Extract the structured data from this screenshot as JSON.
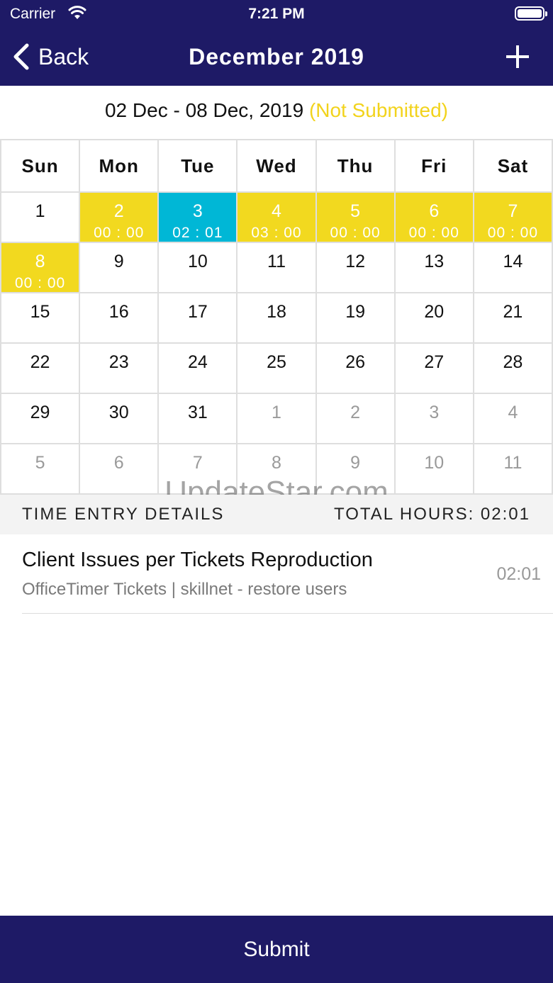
{
  "status_bar": {
    "carrier": "Carrier",
    "time": "7:21 PM",
    "wifi_icon": "wifi-icon",
    "battery_icon": "battery-icon"
  },
  "nav": {
    "back_label": "Back",
    "title": "December 2019",
    "add_icon": "plus-icon"
  },
  "week": {
    "range": "02 Dec - 08 Dec, 2019",
    "status": "(Not Submitted)"
  },
  "colors": {
    "header": "#1e1a66",
    "pending": "#f2d91f",
    "selected": "#00b7d6",
    "status": "#f2d31c"
  },
  "calendar": {
    "weekdays": [
      "Sun",
      "Mon",
      "Tue",
      "Wed",
      "Thu",
      "Fri",
      "Sat"
    ],
    "weeks": [
      [
        {
          "day": "1",
          "hours": "",
          "state": "normal"
        },
        {
          "day": "2",
          "hours": "00 : 00",
          "state": "pending"
        },
        {
          "day": "3",
          "hours": "02 : 01",
          "state": "selected"
        },
        {
          "day": "4",
          "hours": "03 : 00",
          "state": "pending"
        },
        {
          "day": "5",
          "hours": "00 : 00",
          "state": "pending"
        },
        {
          "day": "6",
          "hours": "00 : 00",
          "state": "pending"
        },
        {
          "day": "7",
          "hours": "00 : 00",
          "state": "pending"
        }
      ],
      [
        {
          "day": "8",
          "hours": "00 : 00",
          "state": "pending"
        },
        {
          "day": "9",
          "hours": "",
          "state": "normal"
        },
        {
          "day": "10",
          "hours": "",
          "state": "normal"
        },
        {
          "day": "11",
          "hours": "",
          "state": "normal"
        },
        {
          "day": "12",
          "hours": "",
          "state": "normal"
        },
        {
          "day": "13",
          "hours": "",
          "state": "normal"
        },
        {
          "day": "14",
          "hours": "",
          "state": "normal"
        }
      ],
      [
        {
          "day": "15",
          "hours": "",
          "state": "normal"
        },
        {
          "day": "16",
          "hours": "",
          "state": "normal"
        },
        {
          "day": "17",
          "hours": "",
          "state": "normal"
        },
        {
          "day": "18",
          "hours": "",
          "state": "normal"
        },
        {
          "day": "19",
          "hours": "",
          "state": "normal"
        },
        {
          "day": "20",
          "hours": "",
          "state": "normal"
        },
        {
          "day": "21",
          "hours": "",
          "state": "normal"
        }
      ],
      [
        {
          "day": "22",
          "hours": "",
          "state": "normal"
        },
        {
          "day": "23",
          "hours": "",
          "state": "normal"
        },
        {
          "day": "24",
          "hours": "",
          "state": "normal"
        },
        {
          "day": "25",
          "hours": "",
          "state": "normal"
        },
        {
          "day": "26",
          "hours": "",
          "state": "normal"
        },
        {
          "day": "27",
          "hours": "",
          "state": "normal"
        },
        {
          "day": "28",
          "hours": "",
          "state": "normal"
        }
      ],
      [
        {
          "day": "29",
          "hours": "",
          "state": "normal"
        },
        {
          "day": "30",
          "hours": "",
          "state": "normal"
        },
        {
          "day": "31",
          "hours": "",
          "state": "normal"
        },
        {
          "day": "1",
          "hours": "",
          "state": "out"
        },
        {
          "day": "2",
          "hours": "",
          "state": "out"
        },
        {
          "day": "3",
          "hours": "",
          "state": "out"
        },
        {
          "day": "4",
          "hours": "",
          "state": "out"
        }
      ],
      [
        {
          "day": "5",
          "hours": "",
          "state": "out"
        },
        {
          "day": "6",
          "hours": "",
          "state": "out"
        },
        {
          "day": "7",
          "hours": "",
          "state": "out"
        },
        {
          "day": "8",
          "hours": "",
          "state": "out"
        },
        {
          "day": "9",
          "hours": "",
          "state": "out"
        },
        {
          "day": "10",
          "hours": "",
          "state": "out"
        },
        {
          "day": "11",
          "hours": "",
          "state": "out"
        }
      ]
    ]
  },
  "details": {
    "section_label": "TIME ENTRY DETAILS",
    "total_label": "TOTAL HOURS: 02:01"
  },
  "entries": [
    {
      "title": "Client Issues per Tickets Reproduction",
      "subtitle": "OfficeTimer Tickets | skillnet - restore users",
      "time": "02:01"
    }
  ],
  "watermark": "UpdateStar.com",
  "footer": {
    "submit_label": "Submit"
  }
}
